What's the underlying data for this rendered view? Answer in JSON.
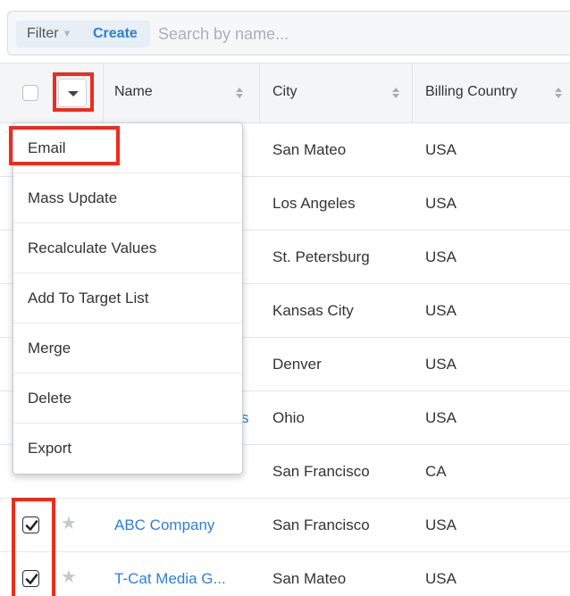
{
  "filter_bar": {
    "filter_label": "Filter",
    "create_label": "Create",
    "search_placeholder": "Search by name..."
  },
  "table": {
    "columns": [
      "Name",
      "City",
      "Billing Country"
    ],
    "rows": [
      {
        "name": "",
        "city": "San Mateo",
        "country": "USA",
        "checked": false
      },
      {
        "name": "",
        "city": "Los Angeles",
        "country": "USA",
        "checked": false
      },
      {
        "name": "",
        "city": "St. Petersburg",
        "country": "USA",
        "checked": false
      },
      {
        "name": "",
        "city": "Kansas City",
        "country": "USA",
        "checked": false
      },
      {
        "name": "",
        "city": "Denver",
        "country": "USA",
        "checked": false
      },
      {
        "name": "s",
        "city": "Ohio",
        "country": "USA",
        "checked": false
      },
      {
        "name": "",
        "city": "San Francisco",
        "country": "CA",
        "checked": false
      },
      {
        "name": "ABC Company",
        "city": "San Francisco",
        "country": "USA",
        "checked": true
      },
      {
        "name": "T-Cat Media G...",
        "city": "San Mateo",
        "country": "USA",
        "checked": true
      }
    ]
  },
  "actions_menu": {
    "items": [
      "Email",
      "Mass Update",
      "Recalculate Values",
      "Add To Target List",
      "Merge",
      "Delete",
      "Export"
    ]
  },
  "icons": {
    "sort": "sort-icon",
    "star": "star-icon",
    "dropdown": "caret-down-icon",
    "checkbox": "checkbox-icon"
  },
  "colors": {
    "link": "#2e7fd5",
    "highlight": "#ee2b1c",
    "header_bg": "#f4f5f6"
  }
}
